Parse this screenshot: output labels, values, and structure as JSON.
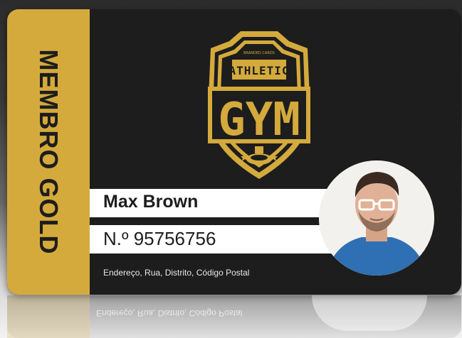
{
  "card": {
    "level_label": "MEMBRO GOLD",
    "logo": {
      "top_text": "ATHLETIC",
      "main_text": "GYM",
      "small_text": "BRANDED CARDS"
    },
    "member_name": "Max Brown",
    "member_number": "N.º 95756756",
    "address": "Endereço, Rua, Distrito, Código Postal"
  },
  "colors": {
    "gold": "#d4aa3c",
    "card_bg": "#1d1d1d",
    "white": "#ffffff"
  },
  "icons": [
    "shield-logo-icon",
    "dumbbell-icon",
    "star-icon",
    "member-photo"
  ]
}
